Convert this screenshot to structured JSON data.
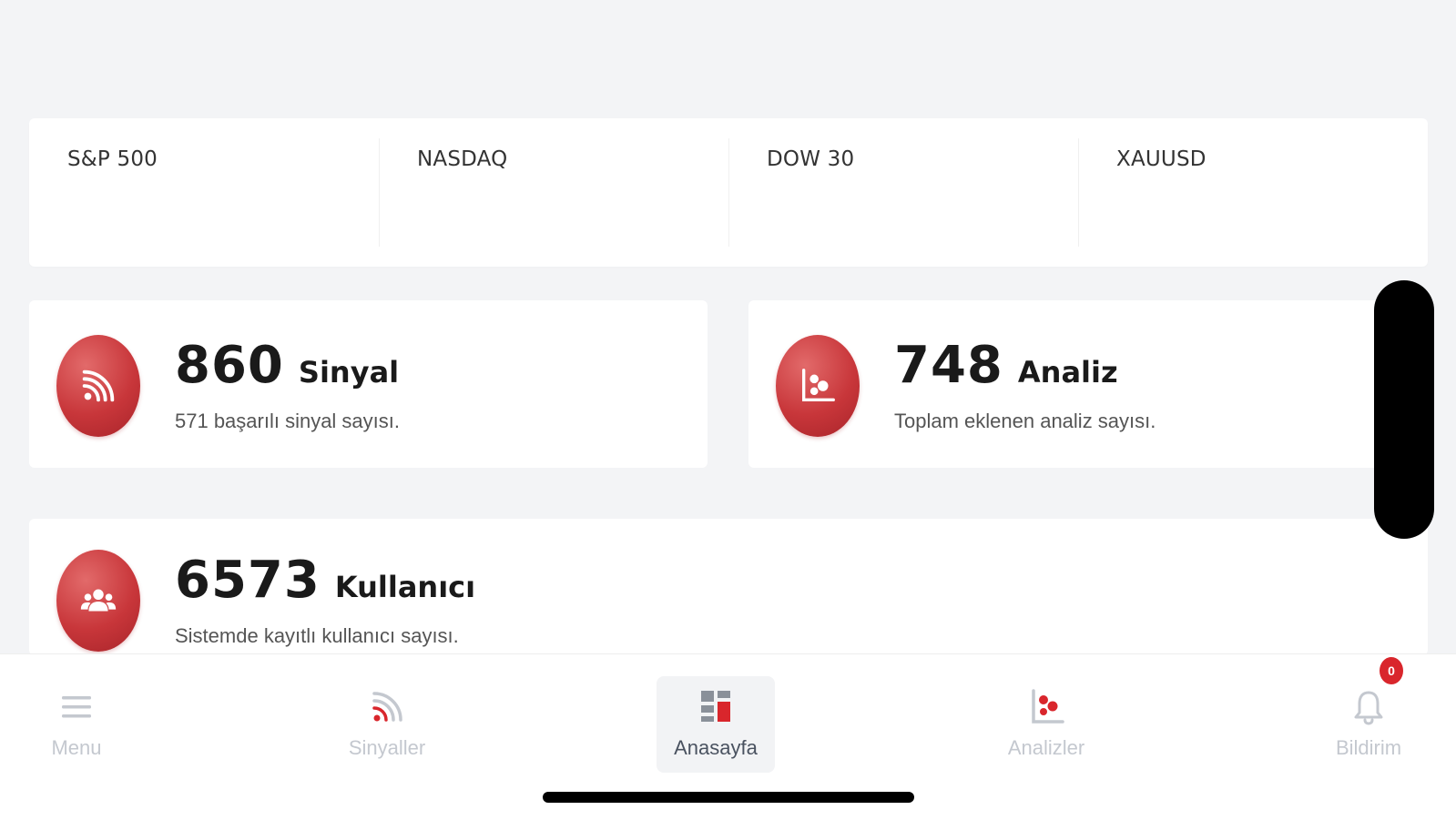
{
  "tickers": [
    {
      "label": "S&P 500"
    },
    {
      "label": "NASDAQ"
    },
    {
      "label": "DOW 30"
    },
    {
      "label": "XAUUSD"
    }
  ],
  "stats": {
    "signal": {
      "number": "860",
      "unit": "Sinyal",
      "subtitle": "571 başarılı sinyal sayısı.",
      "icon": "rss-icon"
    },
    "analysis": {
      "number": "748",
      "unit": "Analiz",
      "subtitle": "Toplam eklenen analiz sayısı.",
      "icon": "analysis-chart-icon"
    },
    "users": {
      "number": "6573",
      "unit": "Kullanıcı",
      "subtitle": "Sistemde kayıtlı kullanıcı sayısı.",
      "icon": "users-icon"
    }
  },
  "nav": {
    "menu": {
      "label": "Menu",
      "icon": "hamburger-icon"
    },
    "signals": {
      "label": "Sinyaller",
      "icon": "rss-icon"
    },
    "home": {
      "label": "Anasayfa",
      "icon": "dashboard-icon"
    },
    "analyses": {
      "label": "Analizler",
      "icon": "analysis-chart-icon"
    },
    "notifications": {
      "label": "Bildirim",
      "icon": "bell-icon",
      "badge": "0"
    }
  },
  "colors": {
    "accent": "#c8363a",
    "background": "#f3f4f6",
    "nav_inactive": "#c4c8cf"
  }
}
